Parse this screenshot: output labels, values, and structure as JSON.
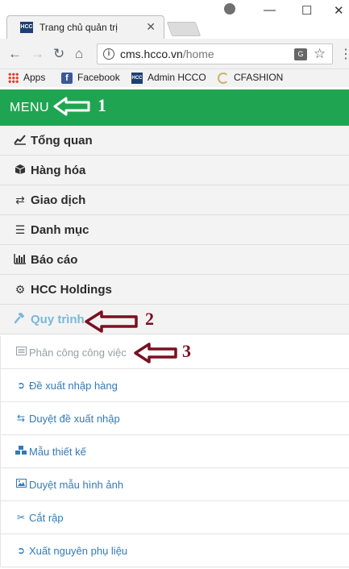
{
  "browser": {
    "tab_title": "Trang chủ quản trị",
    "tab_favicon_text": "HCC",
    "url_domain": "cms.hcco.vn",
    "url_path": "/home",
    "bookmarks": [
      {
        "label": "Apps",
        "icon": "apps-grid-icon"
      },
      {
        "label": "Facebook",
        "icon": "facebook-icon"
      },
      {
        "label": "Admin HCCO",
        "icon": "hcc-logo-icon"
      },
      {
        "label": "CFASHION",
        "icon": "cfashion-icon"
      }
    ]
  },
  "menu_header": {
    "label": "MENU",
    "color": "#1fa552"
  },
  "main_menu": [
    {
      "label": "Tổng quan",
      "icon": "line-chart-icon"
    },
    {
      "label": "Hàng hóa",
      "icon": "cube-icon"
    },
    {
      "label": "Giao dịch",
      "icon": "exchange-icon"
    },
    {
      "label": "Danh mục",
      "icon": "list-icon"
    },
    {
      "label": "Báo cáo",
      "icon": "bar-chart-icon"
    },
    {
      "label": "HCC Holdings",
      "icon": "cogs-icon"
    },
    {
      "label": "Quy trình",
      "icon": "gavel-icon",
      "active": true
    }
  ],
  "sub_menu": [
    {
      "label": "Phân công công việc",
      "icon": "list-alt-icon",
      "current": true
    },
    {
      "label": "Đề xuất nhập hàng",
      "icon": "sign-in-icon"
    },
    {
      "label": "Duyệt đề xuất nhập",
      "icon": "retweet-icon"
    },
    {
      "label": "Mẫu thiết kế",
      "icon": "cubes-icon"
    },
    {
      "label": "Duyệt mẫu hình ảnh",
      "icon": "image-icon"
    },
    {
      "label": "Cắt rập",
      "icon": "scissors-icon"
    },
    {
      "label": "Xuất nguyên phụ liệu",
      "icon": "sign-out-icon"
    }
  ],
  "annotations": [
    {
      "number": "1",
      "color": "#ffffff"
    },
    {
      "number": "2",
      "color": "#7a1020"
    },
    {
      "number": "3",
      "color": "#7a1020"
    }
  ]
}
